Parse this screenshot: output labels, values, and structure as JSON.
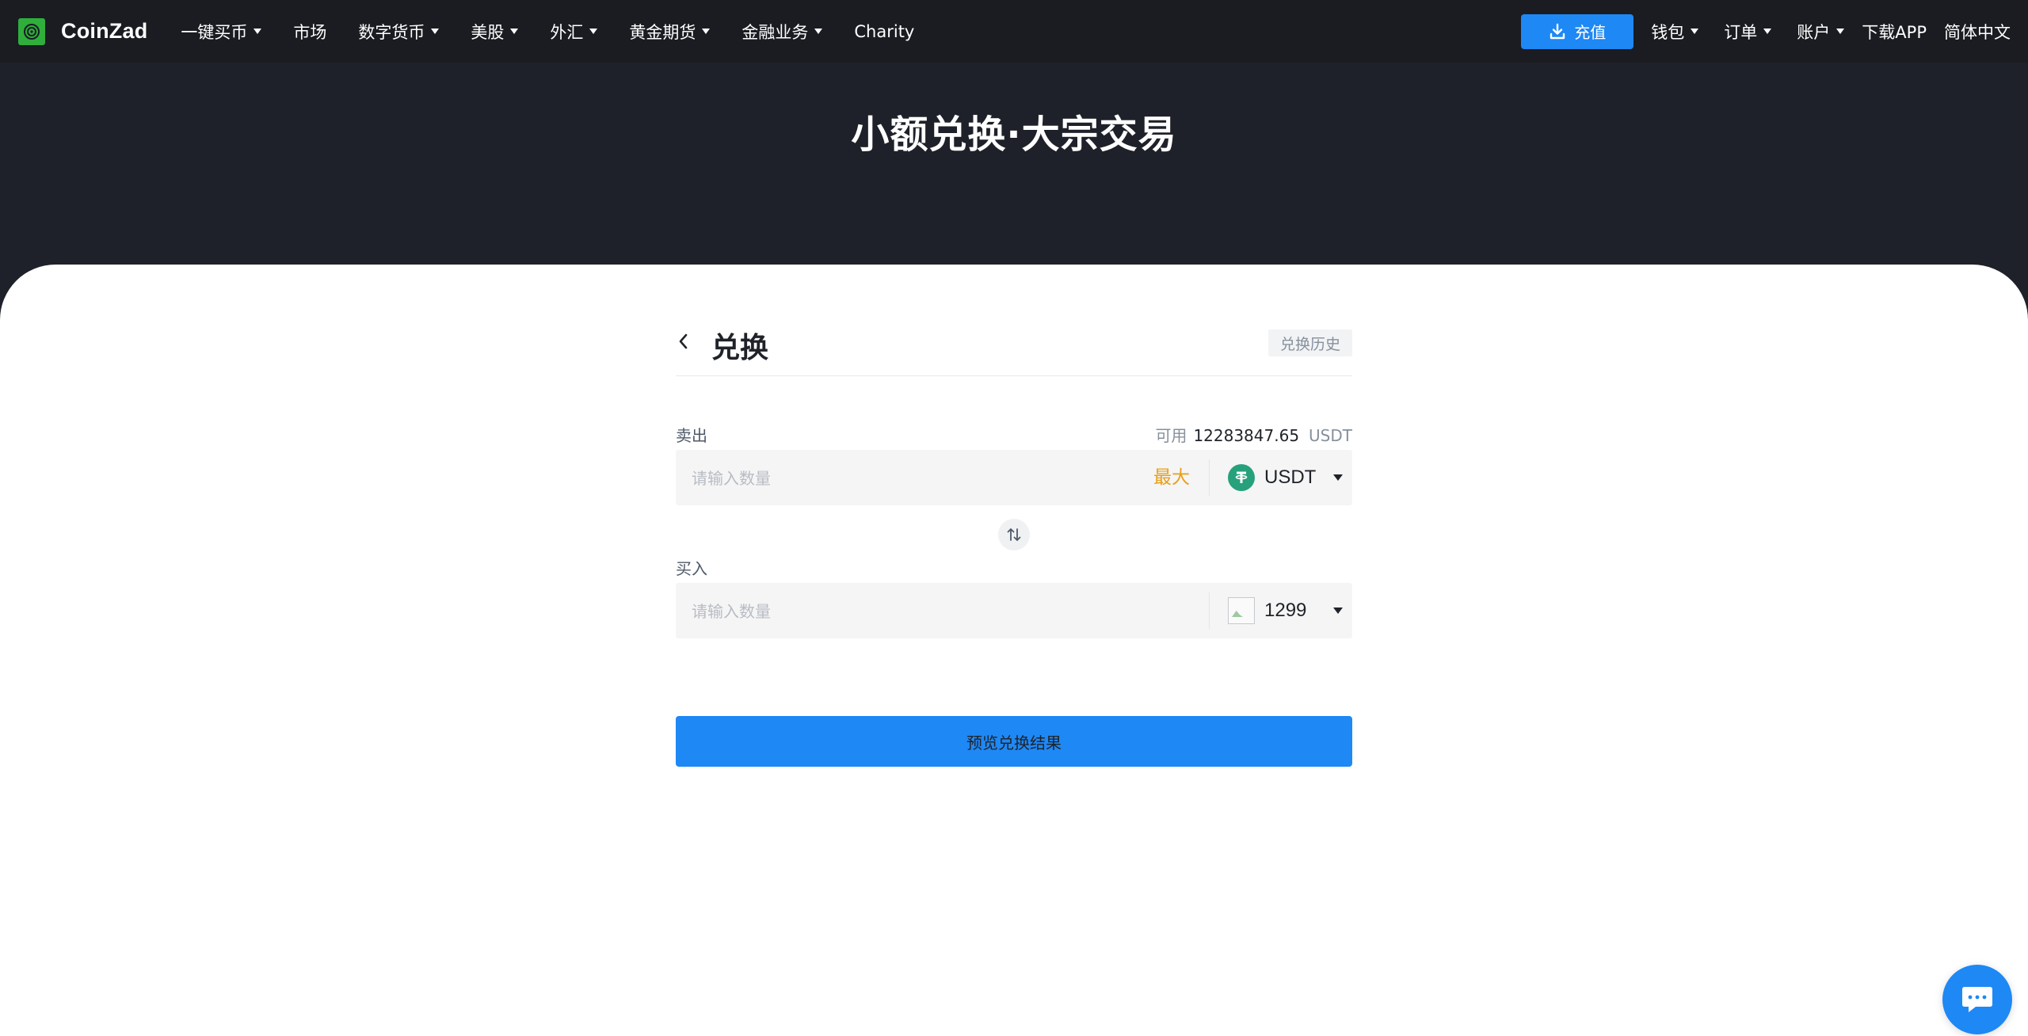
{
  "brand": {
    "name": "CoinZad"
  },
  "nav": {
    "items": [
      {
        "label": "一键买币",
        "dropdown": true
      },
      {
        "label": "市场",
        "dropdown": false
      },
      {
        "label": "数字货币",
        "dropdown": true
      },
      {
        "label": "美股",
        "dropdown": true
      },
      {
        "label": "外汇",
        "dropdown": true
      },
      {
        "label": "黄金期货",
        "dropdown": true
      },
      {
        "label": "金融业务",
        "dropdown": true
      },
      {
        "label": "Charity",
        "dropdown": false
      }
    ],
    "right": {
      "deposit_label": "充值",
      "wallet_label": "钱包",
      "orders_label": "订单",
      "account_label": "账户",
      "download_label": "下载APP",
      "language_label": "简体中文"
    }
  },
  "hero": {
    "title": "小额兑换·大宗交易"
  },
  "exchange": {
    "title": "兑换",
    "history_label": "兑换历史",
    "sell": {
      "label": "卖出",
      "available_prefix": "可用",
      "available_amount": "12283847.65",
      "available_unit": "USDT",
      "placeholder": "请输入数量",
      "max_label": "最大",
      "coin": "USDT"
    },
    "buy": {
      "label": "买入",
      "placeholder": "请输入数量",
      "coin": "1299"
    },
    "preview_label": "预览兑换结果"
  },
  "colors": {
    "accent": "#1e88f5",
    "max": "#e6a01c",
    "header_bg": "#1a1c21",
    "hero_bg": "#1e2129",
    "tether": "#26a17b"
  },
  "icons": {
    "deposit": "download-icon",
    "back": "chevron-left-icon",
    "swap": "swap-vertical-icon",
    "chat": "chat-bubble-icon",
    "logo": "coinzad-logo-icon"
  }
}
